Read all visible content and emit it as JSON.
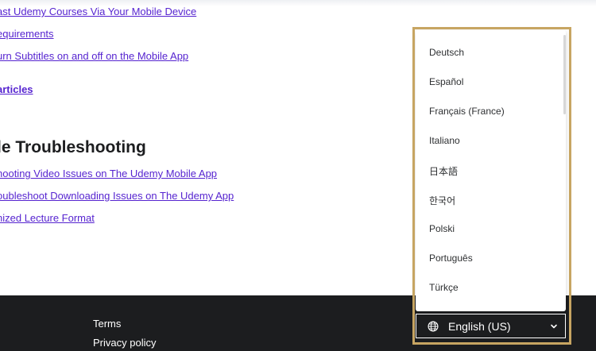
{
  "links_top": [
    "ast Udemy Courses Via Your Mobile Device",
    "equirements",
    "urn Subtitles on and off on the Mobile App"
  ],
  "see_all_articles": "articles",
  "section": {
    "title": "le Troubleshooting",
    "links": [
      "hooting Video Issues on The Udemy Mobile App",
      "oubleshoot Downloading Issues on The Udemy App",
      "nized Lecture Format"
    ]
  },
  "footer": {
    "links": [
      "Terms",
      "Privacy policy"
    ]
  },
  "language_menu": {
    "options": [
      "Deutsch",
      "Español",
      "Français (France)",
      "Italiano",
      "日本語",
      "한국어",
      "Polski",
      "Português",
      "Türkçe"
    ],
    "selected": "English (US)",
    "button_icon": "globe-icon",
    "chevron_icon": "chevron-down-icon"
  },
  "colors": {
    "link": "#5624d0",
    "footer_bg": "#1c1d1f",
    "highlight_border": "#c7a562"
  }
}
